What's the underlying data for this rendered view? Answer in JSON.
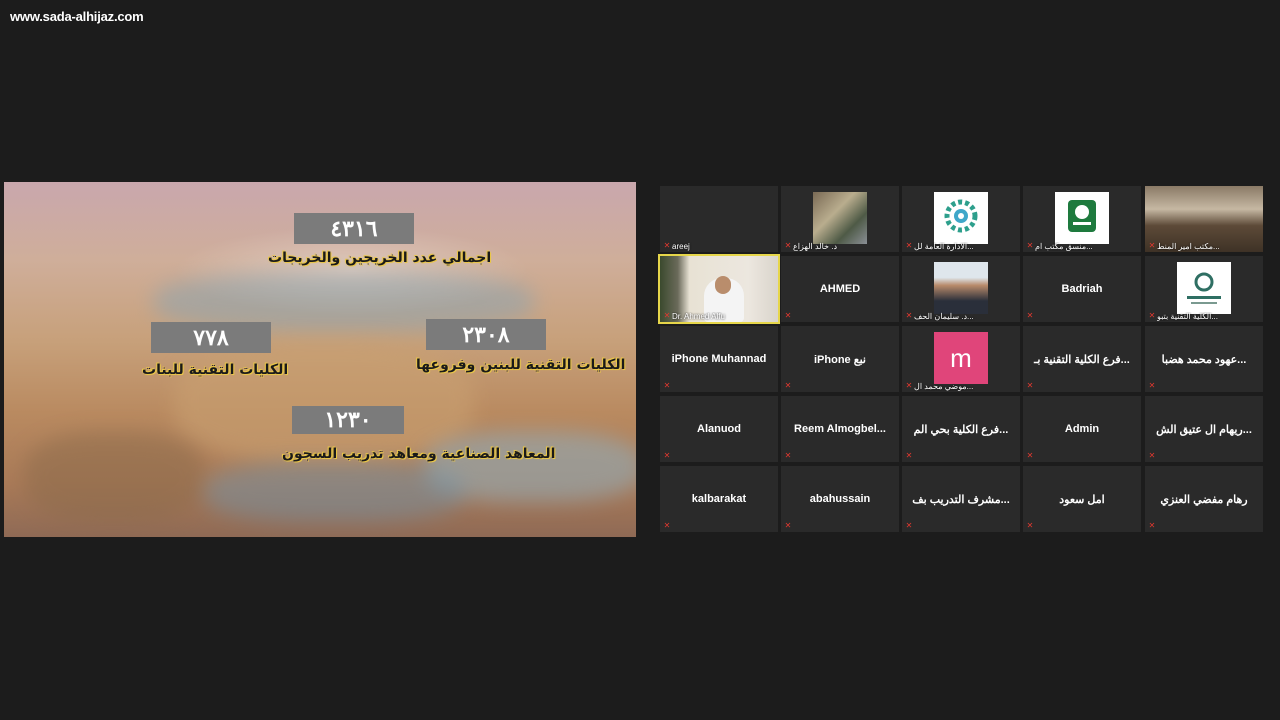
{
  "watermark": "www.sada-alhijaz.com",
  "share": {
    "stats": [
      {
        "value": "٤٣١٦",
        "label": "اجمالي عدد الخريجين والخريجات"
      },
      {
        "value": "٢٣٠٨",
        "label": "الكليات التقنية للبنين وفروعها"
      },
      {
        "value": "٧٧٨",
        "label": "الكليات التقنية للبنات"
      },
      {
        "value": "١٢٣٠",
        "label": "المعاهد الصناعية ومعاهد تدريب السجون"
      }
    ]
  },
  "participants": [
    {
      "name": "",
      "footer": "areej"
    },
    {
      "name": "",
      "footer": "د. خالد الهزاع"
    },
    {
      "name": "",
      "footer": "الادارة العامة لل..."
    },
    {
      "name": "",
      "footer": "منسق مكتب ام..."
    },
    {
      "name": "",
      "footer": "مكتب امير المنط..."
    },
    {
      "name": "",
      "footer": "Dr. Ahmed Alfu"
    },
    {
      "name": "AHMED",
      "footer": ""
    },
    {
      "name": "",
      "footer": "د. سليمان الحف..."
    },
    {
      "name": "Badriah",
      "footer": ""
    },
    {
      "name": "",
      "footer": "الكلية التقنية بتبو..."
    },
    {
      "name": "iPhone Muhannad",
      "footer": ""
    },
    {
      "name": "iPhone نبع",
      "footer": ""
    },
    {
      "name": "",
      "footer": "موضي محمد ال..."
    },
    {
      "name": "فرع الكلية التقنية بـ...",
      "footer": ""
    },
    {
      "name": "عهود محمد هضبا...",
      "footer": ""
    },
    {
      "name": "Alanuod",
      "footer": ""
    },
    {
      "name": "Reem Almogbel...",
      "footer": ""
    },
    {
      "name": "فرع الكلية بحي الم...",
      "footer": ""
    },
    {
      "name": "Admin",
      "footer": ""
    },
    {
      "name": "ريهام ال عتيق الش...",
      "footer": ""
    },
    {
      "name": "kalbarakat",
      "footer": ""
    },
    {
      "name": "abahussain",
      "footer": ""
    },
    {
      "name": "مشرف التدريب بف...",
      "footer": ""
    },
    {
      "name": "امل سعود",
      "footer": ""
    },
    {
      "name": "رهام مفضي العنزي",
      "footer": ""
    }
  ],
  "avatar_letter": "m",
  "colors": {
    "active_border": "#e6d64a",
    "muted_mic": "#e0382f",
    "avatar_m": "#e0457a"
  }
}
